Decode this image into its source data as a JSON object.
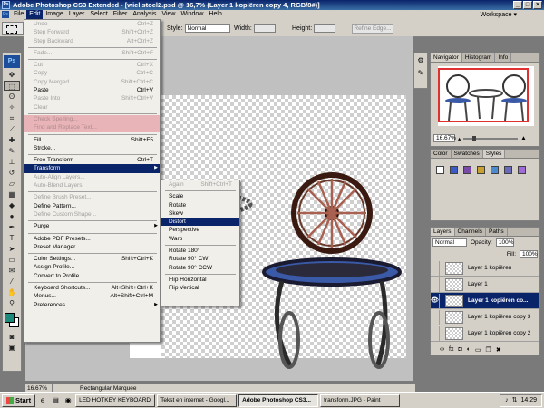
{
  "window": {
    "title": "Adobe Photoshop CS3 Extended - [wiel stoel2.psd @ 16,7% (Layer 1 kopiëren copy 4, RGB/8#)]",
    "app_icon": "Ps"
  },
  "menubar": {
    "items": [
      "File",
      "Edit",
      "Image",
      "Layer",
      "Select",
      "Filter",
      "Analysis",
      "View",
      "Window",
      "Help"
    ],
    "active": "Edit",
    "workspace_label": "Workspace"
  },
  "options": {
    "style_label": "Style:",
    "style_value": "Normal",
    "width_label": "Width:",
    "height_label": "Height:",
    "refine_edge_label": "Refine Edge..."
  },
  "toolbox": {
    "logo": "Ps",
    "foreground_color": "#1b8a7a",
    "background_color": "#ffffff"
  },
  "edit_menu": [
    {
      "label": "Undo",
      "shortcut": "Ctrl+Z",
      "state": "disabled"
    },
    {
      "label": "Step Forward",
      "shortcut": "Shift+Ctrl+Z",
      "state": "disabled"
    },
    {
      "label": "Step Backward",
      "shortcut": "Alt+Ctrl+Z",
      "state": "disabled"
    },
    {
      "sep": true
    },
    {
      "label": "Fade...",
      "shortcut": "Shift+Ctrl+F",
      "state": "disabled"
    },
    {
      "sep": true
    },
    {
      "label": "Cut",
      "shortcut": "Ctrl+X",
      "state": "disabled"
    },
    {
      "label": "Copy",
      "shortcut": "Ctrl+C",
      "state": "disabled"
    },
    {
      "label": "Copy Merged",
      "shortcut": "Shift+Ctrl+C",
      "state": "disabled"
    },
    {
      "label": "Paste",
      "shortcut": "Ctrl+V",
      "state": "enabled"
    },
    {
      "label": "Paste Into",
      "shortcut": "Shift+Ctrl+V",
      "state": "disabled"
    },
    {
      "label": "Clear",
      "shortcut": "",
      "state": "disabled"
    },
    {
      "sep": true
    },
    {
      "label": "Check Spelling...",
      "shortcut": "",
      "state": "pink"
    },
    {
      "label": "Find and Replace Text...",
      "shortcut": "",
      "state": "pink"
    },
    {
      "sep": true
    },
    {
      "label": "Fill...",
      "shortcut": "Shift+F5",
      "state": "enabled"
    },
    {
      "label": "Stroke...",
      "shortcut": "",
      "state": "enabled"
    },
    {
      "sep": true
    },
    {
      "label": "Free Transform",
      "shortcut": "Ctrl+T",
      "state": "enabled"
    },
    {
      "label": "Transform",
      "shortcut": "",
      "state": "highlighted",
      "submenu": true
    },
    {
      "label": "Auto-Align Layers...",
      "shortcut": "",
      "state": "disabled"
    },
    {
      "label": "Auto-Blend Layers",
      "shortcut": "",
      "state": "disabled"
    },
    {
      "sep": true
    },
    {
      "label": "Define Brush Preset...",
      "shortcut": "",
      "state": "disabled"
    },
    {
      "label": "Define Pattern...",
      "shortcut": "",
      "state": "enabled"
    },
    {
      "label": "Define Custom Shape...",
      "shortcut": "",
      "state": "disabled"
    },
    {
      "sep": true
    },
    {
      "label": "Purge",
      "shortcut": "",
      "state": "enabled",
      "submenu": true
    },
    {
      "sep": true
    },
    {
      "label": "Adobe PDF Presets...",
      "shortcut": "",
      "state": "enabled"
    },
    {
      "label": "Preset Manager...",
      "shortcut": "",
      "state": "enabled"
    },
    {
      "sep": true
    },
    {
      "label": "Color Settings...",
      "shortcut": "Shift+Ctrl+K",
      "state": "enabled"
    },
    {
      "label": "Assign Profile...",
      "shortcut": "",
      "state": "enabled"
    },
    {
      "label": "Convert to Profile...",
      "shortcut": "",
      "state": "enabled"
    },
    {
      "sep": true
    },
    {
      "label": "Keyboard Shortcuts...",
      "shortcut": "Alt+Shift+Ctrl+K",
      "state": "enabled"
    },
    {
      "label": "Menus...",
      "shortcut": "Alt+Shift+Ctrl+M",
      "state": "enabled"
    },
    {
      "label": "Preferences",
      "shortcut": "",
      "state": "enabled",
      "submenu": true
    }
  ],
  "transform_submenu": [
    {
      "label": "Again",
      "shortcut": "Shift+Ctrl+T",
      "state": "disabled"
    },
    {
      "sep": true
    },
    {
      "label": "Scale",
      "state": "enabled"
    },
    {
      "label": "Rotate",
      "state": "enabled"
    },
    {
      "label": "Skew",
      "state": "enabled"
    },
    {
      "label": "Distort",
      "state": "highlighted"
    },
    {
      "label": "Perspective",
      "state": "enabled"
    },
    {
      "label": "Warp",
      "state": "enabled"
    },
    {
      "sep": true
    },
    {
      "label": "Rotate 180°",
      "state": "enabled"
    },
    {
      "label": "Rotate 90° CW",
      "state": "enabled"
    },
    {
      "label": "Rotate 90° CCW",
      "state": "enabled"
    },
    {
      "sep": true
    },
    {
      "label": "Flip Horizontal",
      "state": "enabled"
    },
    {
      "label": "Flip Vertical",
      "state": "enabled"
    }
  ],
  "status": {
    "zoom": "16.67%",
    "info": "Rectangular Marquee"
  },
  "navigator": {
    "tabs": [
      "Navigator",
      "Histogram",
      "Info"
    ],
    "zoom": "16.67%"
  },
  "color_panel": {
    "tabs": [
      "Color",
      "Swatches",
      "Styles"
    ],
    "style_swatches": [
      "#ffffff",
      "#3a5ac8",
      "#7a4aa8",
      "#c8a030",
      "#4a8acd",
      "#6a6ab8",
      "#a06ad8"
    ]
  },
  "layers": {
    "tabs": [
      "Layers",
      "Channels",
      "Paths"
    ],
    "blend_mode": "Normal",
    "opacity_label": "Opacity:",
    "opacity": "100%",
    "fill_label": "Fill:",
    "fill": "100%",
    "rows": [
      {
        "name": "Layer 1 kopiëren",
        "visible": false,
        "selected": false
      },
      {
        "name": "Layer 1",
        "visible": false,
        "selected": false
      },
      {
        "name": "Layer 1 kopiëren co...",
        "visible": true,
        "selected": true
      },
      {
        "name": "Layer 1 kopiëren copy 3",
        "visible": false,
        "selected": false
      },
      {
        "name": "Layer 1 kopiëren copy 2",
        "visible": false,
        "selected": false
      }
    ]
  },
  "taskbar": {
    "start": "Start",
    "items": [
      {
        "label": "LED HOTKEY KEYBOARD",
        "active": false
      },
      {
        "label": "Tekst en internet - Googl...",
        "active": false
      },
      {
        "label": "Adobe Photoshop CS3...",
        "active": true
      },
      {
        "label": "transform.JPG - Paint",
        "active": false
      }
    ],
    "clock": "14:29"
  }
}
